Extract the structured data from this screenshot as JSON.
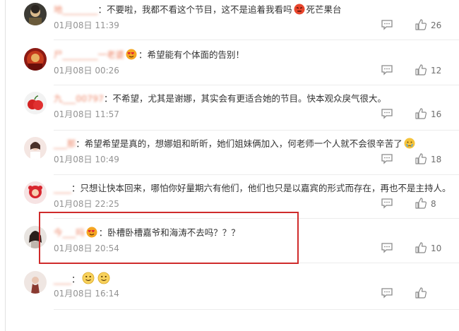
{
  "comments": [
    {
      "username": "地________",
      "text": "：不要啦，我都不看这个节目，这不是追着我看吗",
      "emoji_inline": "angry-face-emoji",
      "text_after_emoji": "死芒果台",
      "time": "01月08日 11:39",
      "likes": "26"
    },
    {
      "username": "尸________一老婆",
      "emoji_inline": "heart-eyes-emoji",
      "text": "：希望能有个体面的告别！",
      "time": "01月08日 00:26",
      "likes": "12"
    },
    {
      "username": "九___00797",
      "text": "：不希望，尤其是谢娜，其实会有更适合她的节目。快本观众戾气很大。",
      "time": "01月08日 11:57",
      "likes": "16"
    },
    {
      "username": "___那",
      "text": "：希望希望是真的，想娜姐和昕昕，她们姐妹俩加入，何老师一个人就不会很辛苦了",
      "emoji_inline": "teary-face-emoji",
      "time": "01月08日 10:49",
      "likes": "18"
    },
    {
      "username": "____",
      "text": "：只想让快本回来，哪怕你好量期六有他们，他们也只是以嘉宾的形式而存在，再也不是主持人。",
      "time": "01月08日 22:25",
      "likes": "8"
    },
    {
      "username": "今___吗",
      "emoji_inline": "heart-eyes-emoji",
      "text": "：卧槽卧槽嘉爷和海涛不去吗？？？",
      "time": "01月08日 20:54",
      "likes": "10"
    },
    {
      "username": "____",
      "text": "：",
      "emoji_inline": "smiley-emoji",
      "time": "01月08日 16:14",
      "likes": ""
    }
  ]
}
